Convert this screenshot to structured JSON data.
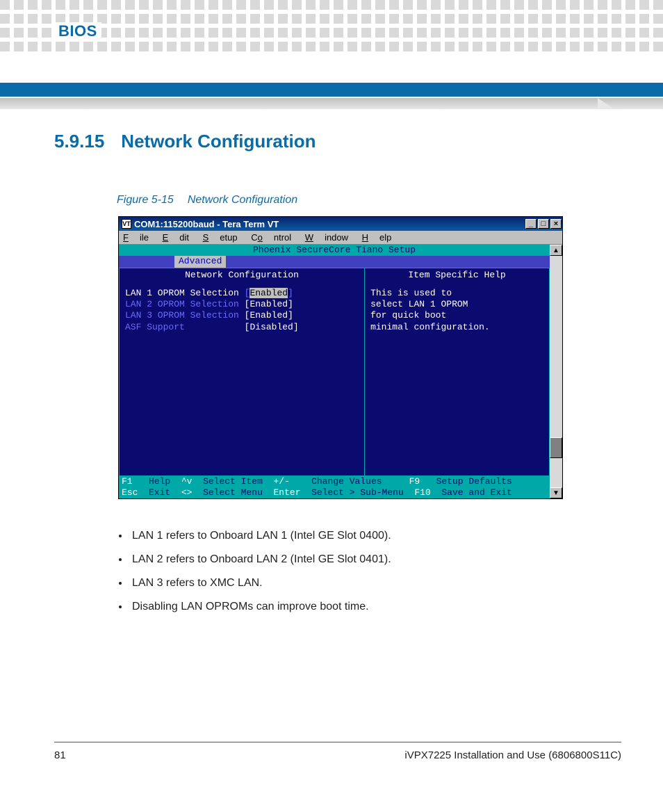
{
  "page": {
    "chapter_label": "BIOS",
    "section_number": "5.9.15",
    "section_title": "Network Configuration",
    "figure_label": "Figure 5-15",
    "figure_title": "Network Configuration",
    "page_number": "81",
    "doc_title": "iVPX7225 Installation and Use (6806800S11C)"
  },
  "teraterm": {
    "title": "COM1:115200baud - Tera Term VT",
    "menus": [
      "File",
      "Edit",
      "Setup",
      "Control",
      "Window",
      "Help"
    ],
    "winbtn_minimize": "_",
    "winbtn_maximize": "□",
    "winbtn_close": "×",
    "scroll_up": "▲",
    "scroll_down": "▼"
  },
  "bios": {
    "header": "Phoenix SecureCore Tiano Setup",
    "tab": "Advanced",
    "panel_title": "Network Configuration",
    "help_title": "Item Specific Help",
    "options": [
      {
        "label": "LAN 1 OPROM Selection",
        "value": "Enabled",
        "selected": true
      },
      {
        "label": "LAN 2 OPROM Selection",
        "value": "Enabled",
        "selected": false
      },
      {
        "label": "LAN 3 OPROM Selection",
        "value": "Enabled",
        "selected": false
      },
      {
        "label": "ASF Support",
        "value": "Disabled",
        "selected": false
      }
    ],
    "help_text": "This is used to\nselect LAN 1 OPROM\nfor quick boot\nminimal configuration.",
    "footer": {
      "f1": "F1",
      "help": "Help",
      "esc": "Esc",
      "exit": "Exit",
      "updown": "^v",
      "select_item": "Select Item",
      "leftright": "<>",
      "select_menu": "Select Menu",
      "plusminus": "+/-",
      "change_values": "Change Values",
      "enter": "Enter",
      "sub_menu": "Select > Sub-Menu",
      "f9": "F9",
      "setup_defaults": "Setup Defaults",
      "f10": "F10",
      "save_exit": "Save and Exit"
    }
  },
  "bullets": [
    "LAN 1 refers to Onboard LAN 1 (Intel GE Slot 0400).",
    "LAN 2 refers to Onboard LAN 2 (Intel GE Slot 0401).",
    "LAN 3 refers to XMC LAN.",
    "Disabling LAN OPROMs can improve boot time."
  ]
}
